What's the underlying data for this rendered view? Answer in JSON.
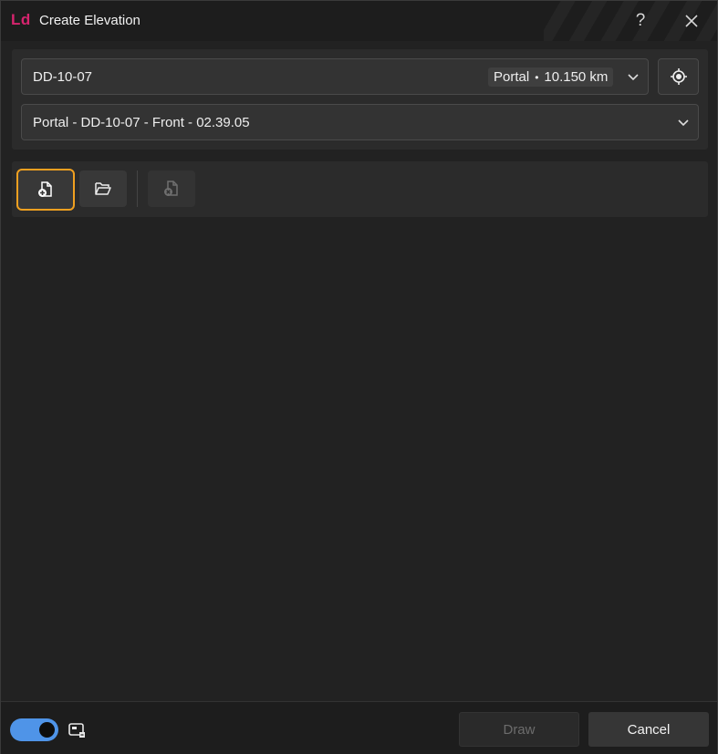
{
  "window": {
    "logo": "Ld",
    "title": "Create Elevation",
    "help_icon": "question-icon",
    "close_icon": "close-icon",
    "accent_color": "#d6246e"
  },
  "location": {
    "value": "DD-10-07",
    "badge_type": "Portal",
    "badge_sep": "•",
    "badge_distance": "10.150 km",
    "dropdown_icon": "chevron-down-icon",
    "locate_icon": "locate-target-icon"
  },
  "elevation": {
    "value": "Portal - DD-10-07 - Front - 02.39.05",
    "dropdown_icon": "chevron-down-icon"
  },
  "toolbar": {
    "new_icon": "new-document-plus-icon",
    "open_icon": "open-folder-icon",
    "delete_icon": "delete-document-icon",
    "highlight_color": "#f0a020"
  },
  "footer": {
    "toggle_on": true,
    "toggle_color": "#4f94e8",
    "view_icon": "window-view-icon",
    "draw_label": "Draw",
    "draw_enabled": false,
    "cancel_label": "Cancel"
  }
}
